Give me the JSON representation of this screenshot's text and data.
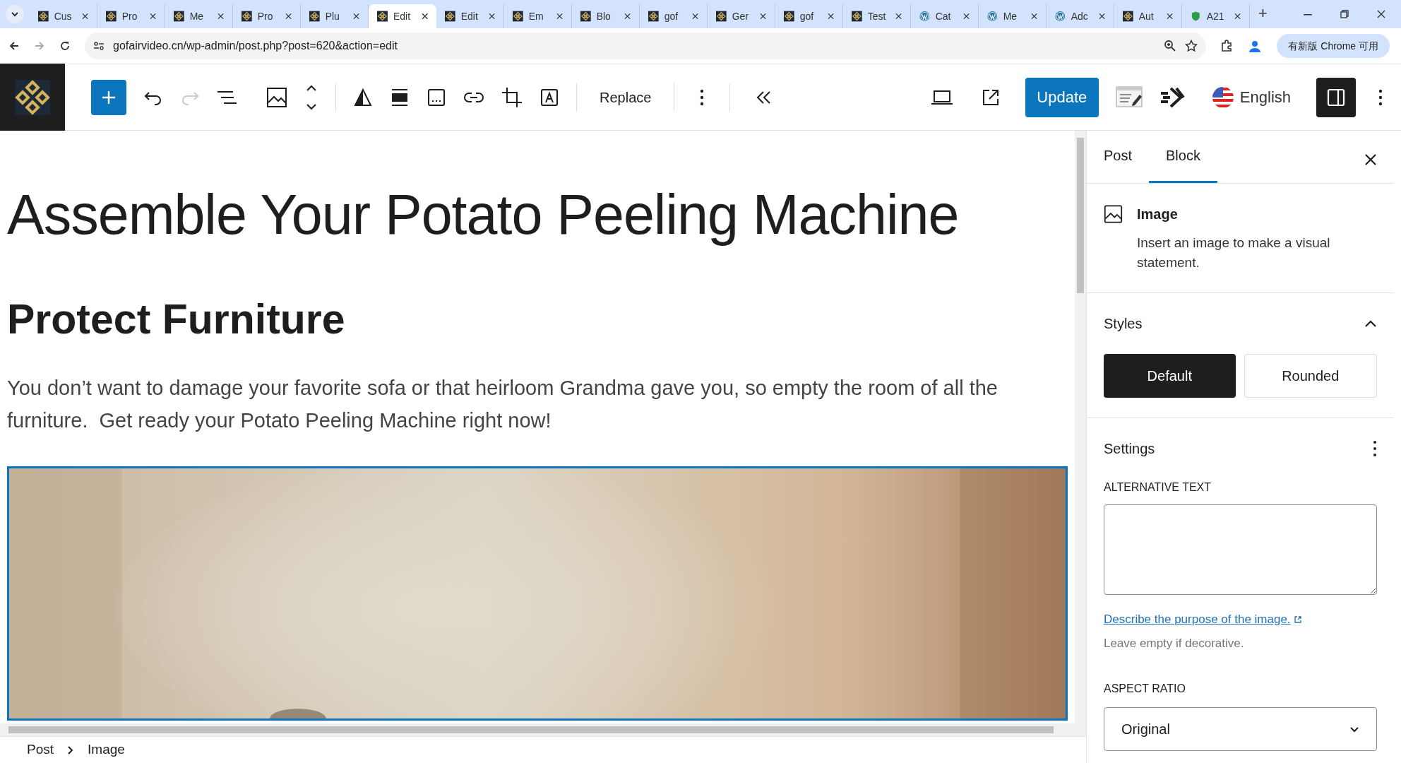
{
  "browser": {
    "tabs": [
      {
        "label": "Cus",
        "kind": "logo",
        "selected": false
      },
      {
        "label": "Pro",
        "kind": "logo",
        "selected": false
      },
      {
        "label": "Me",
        "kind": "logo",
        "selected": false
      },
      {
        "label": "Pro",
        "kind": "logo",
        "selected": false
      },
      {
        "label": "Plu",
        "kind": "logo",
        "selected": false
      },
      {
        "label": "Edit",
        "kind": "logo",
        "selected": true
      },
      {
        "label": "Edit",
        "kind": "logo",
        "selected": false
      },
      {
        "label": "Em",
        "kind": "logo",
        "selected": false
      },
      {
        "label": "Blo",
        "kind": "logo",
        "selected": false
      },
      {
        "label": "gof",
        "kind": "logo",
        "selected": false
      },
      {
        "label": "Ger",
        "kind": "logo",
        "selected": false
      },
      {
        "label": "gof",
        "kind": "logo",
        "selected": false
      },
      {
        "label": "Test",
        "kind": "logo",
        "selected": false
      },
      {
        "label": "Cat",
        "kind": "wp",
        "selected": false
      },
      {
        "label": "Me",
        "kind": "wp",
        "selected": false
      },
      {
        "label": "Adc",
        "kind": "wp",
        "selected": false
      },
      {
        "label": "Aut",
        "kind": "logo",
        "selected": false
      },
      {
        "label": "A21",
        "kind": "shield",
        "selected": false
      }
    ],
    "new_tab": "+",
    "url": "gofairvideo.cn/wp-admin/post.php?post=620&action=edit",
    "update_chip": "有新版 Chrome 可用"
  },
  "toolbar": {
    "replace": "Replace",
    "update": "Update",
    "language": "English"
  },
  "content": {
    "title": "Assemble Your Potato Peeling Machine",
    "heading": "Protect Furniture",
    "paragraph": "You don’t want to damage your favorite sofa or that heirloom Grandma gave you, so empty the room of all the furniture.  Get ready your Potato Peeling Machine right now!"
  },
  "sidebar": {
    "tabs": [
      {
        "label": "Post",
        "selected": false
      },
      {
        "label": "Block",
        "selected": true
      }
    ],
    "block": {
      "name": "Image",
      "description": "Insert an image to make a visual statement."
    },
    "styles": {
      "title": "Styles",
      "options": [
        {
          "label": "Default",
          "selected": true
        },
        {
          "label": "Rounded",
          "selected": false
        }
      ]
    },
    "settings": {
      "title": "Settings",
      "alt_label": "ALTERNATIVE TEXT",
      "help_link": "Describe the purpose of the image.",
      "help_text": "Leave empty if decorative.",
      "aspect_label": "ASPECT RATIO",
      "aspect_value": "Original"
    }
  },
  "breadcrumb": [
    "Post",
    "Image"
  ]
}
